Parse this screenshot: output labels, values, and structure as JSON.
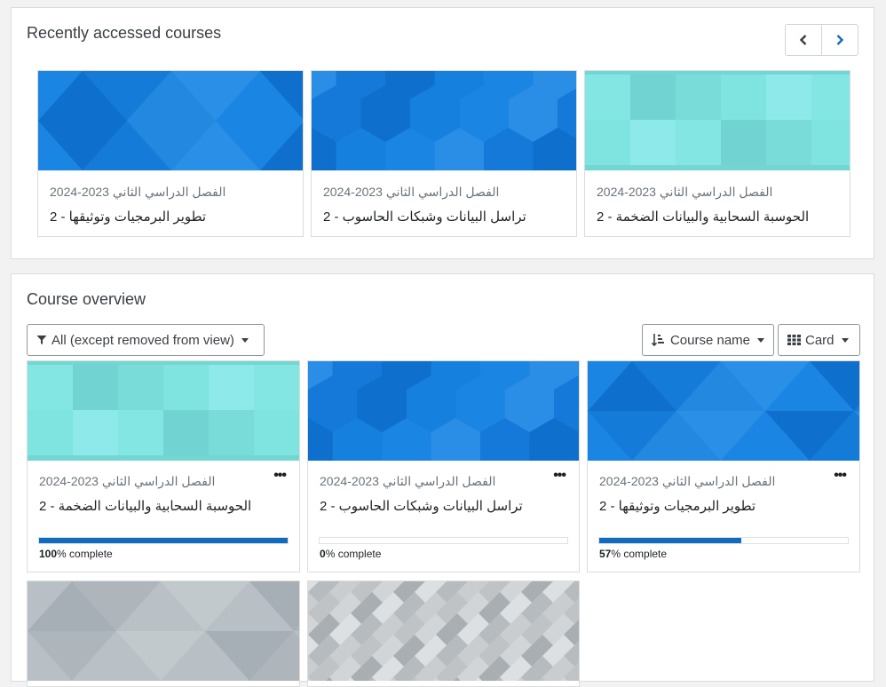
{
  "recent": {
    "title": "Recently accessed courses",
    "nav": {
      "prev_icon": "chevron-left-icon",
      "next_icon": "chevron-right-icon"
    },
    "courses": [
      {
        "category": "الفصل الدراسي الثاني 2023-2024",
        "name": "تطوير البرمجيات وتوثيقها - 2",
        "image": "blue-triangles"
      },
      {
        "category": "الفصل الدراسي الثاني 2023-2024",
        "name": "تراسل البيانات وشبكات الحاسوب - 2",
        "image": "blue-hexagons"
      },
      {
        "category": "الفصل الدراسي الثاني 2023-2024",
        "name": "الحوسبة السحابية والبيانات الضخمة - 2",
        "image": "teal-squares"
      }
    ]
  },
  "overview": {
    "title": "Course overview",
    "filter": {
      "label": "All (except removed from view)",
      "icon": "filter-icon"
    },
    "sort": {
      "label": "Course name",
      "icon": "sort-icon"
    },
    "view": {
      "label": "Card",
      "icon": "grid-icon"
    },
    "courses": [
      {
        "category": "الفصل الدراسي الثاني 2023-2024",
        "name": "الحوسبة السحابية والبيانات الضخمة - 2",
        "progress_value": "100",
        "progress_suffix": "% complete",
        "progress": 1.0,
        "image": "teal-squares"
      },
      {
        "category": "الفصل الدراسي الثاني 2023-2024",
        "name": "تراسل البيانات وشبكات الحاسوب - 2",
        "progress_value": "0",
        "progress_suffix": "% complete",
        "progress": 0.0,
        "image": "blue-hexagons"
      },
      {
        "category": "الفصل الدراسي الثاني 2023-2024",
        "name": "تطوير البرمجيات وتوثيقها - 2",
        "progress_value": "57",
        "progress_suffix": "% complete",
        "progress": 0.57,
        "image": "blue-triangles"
      },
      {
        "image": "gray-triangles"
      },
      {
        "image": "gray-diamonds"
      }
    ]
  },
  "colors": {
    "accent": "#0f6cbf",
    "blue": "#1a82e0",
    "teal": "#7fe3e0",
    "gray": "#b3bbc0"
  }
}
